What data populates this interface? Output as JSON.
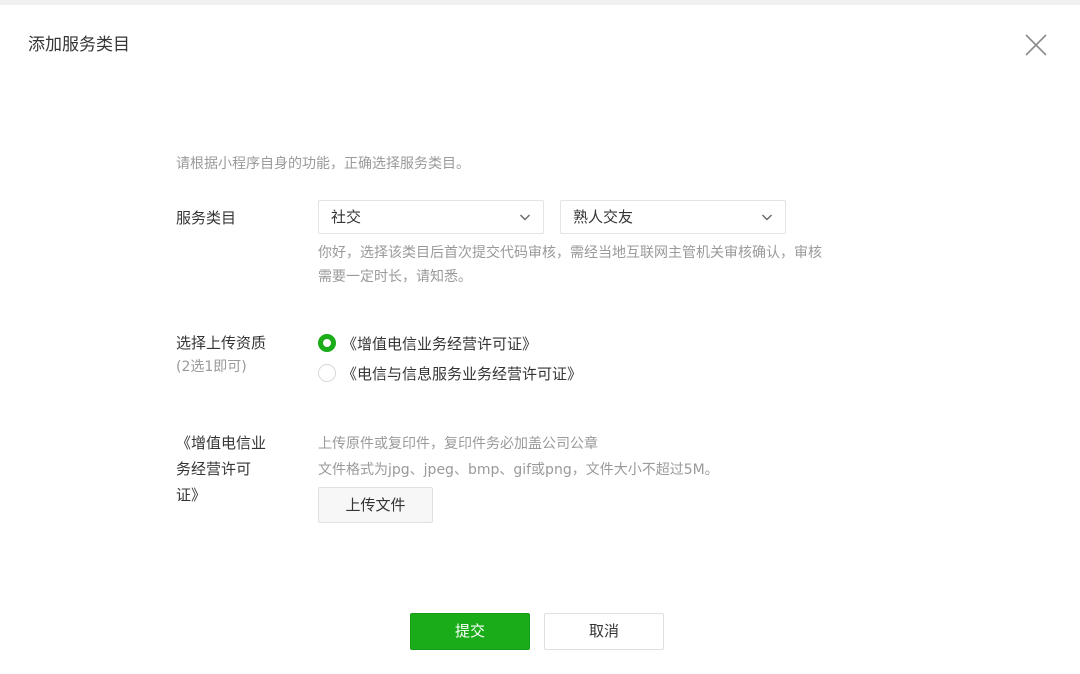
{
  "dialog": {
    "title": "添加服务类目",
    "close_icon": "close-icon"
  },
  "form": {
    "intro": "请根据小程序自身的功能，正确选择服务类目。",
    "category": {
      "label": "服务类目",
      "primary_value": "社交",
      "secondary_value": "熟人交友",
      "tip_line1": "你好，选择该类目后首次提交代码审核，需经当地互联网主管机关审核确认，审核",
      "tip_line2": "需要一定时长，请知悉。"
    },
    "qualification": {
      "label": "选择上传资质",
      "sub_label": "(2选1即可)",
      "options": [
        {
          "label": "《增值电信业务经营许可证》",
          "checked": true
        },
        {
          "label": "《电信与信息服务业务经营许可证》",
          "checked": false
        }
      ]
    },
    "upload": {
      "label_line1": "《增值电信业",
      "label_line2": "务经营许可",
      "label_line3": "证》",
      "tip_line1": "上传原件或复印件，复印件务必加盖公司公章",
      "tip_line2": "文件格式为jpg、jpeg、bmp、gif或png，文件大小不超过5M。",
      "button_label": "上传文件"
    }
  },
  "footer": {
    "submit_label": "提交",
    "cancel_label": "取消"
  },
  "colors": {
    "accent": "#1aad19",
    "muted_text": "#9a9a9a",
    "text": "#353535",
    "border": "#e4e4e4"
  }
}
